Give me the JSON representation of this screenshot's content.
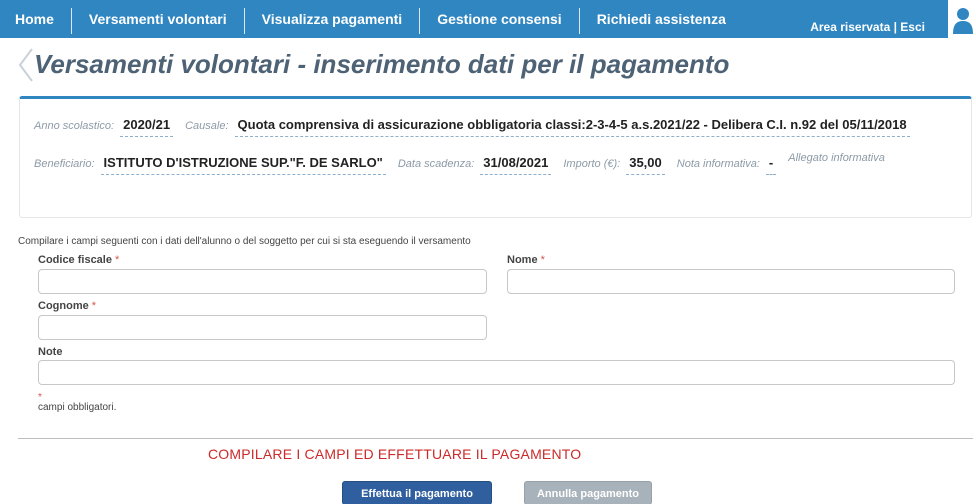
{
  "nav": {
    "items": [
      {
        "label": "Home"
      },
      {
        "label": "Versamenti volontari"
      },
      {
        "label": "Visualizza pagamenti"
      },
      {
        "label": "Gestione consensi"
      },
      {
        "label": "Richiedi assistenza"
      }
    ],
    "area_link": "Area riservata | Esci",
    "user_icon": "user-silhouette-icon",
    "bar_color": "#2f86c0"
  },
  "page": {
    "title": "Versamenti volontari - inserimento dati per il pagamento"
  },
  "info": {
    "anno_label": "Anno scolastico:",
    "anno_value": "2020/21",
    "causale_label": "Causale:",
    "causale_value": "Quota comprensiva di assicurazione obbligatoria classi:2-3-4-5 a.s.2021/22 - Delibera C.I. n.92 del 05/11/2018",
    "beneficiario_label": "Beneficiario:",
    "beneficiario_value": "ISTITUTO D'ISTRUZIONE SUP.\"F. DE SARLO\"",
    "scadenza_label": "Data scadenza:",
    "scadenza_value": "31/08/2021",
    "importo_label": "Importo (€):",
    "importo_value": "35,00",
    "nota_label": "Nota informativa:",
    "nota_value": "-",
    "allegato_label": "Allegato informativa"
  },
  "form": {
    "intro": "Compilare i campi seguenti con i dati dell'alunno o del soggetto per cui si sta eseguendo il versamento",
    "codice_fiscale_label": "Codice fiscale",
    "nome_label": "Nome",
    "cognome_label": "Cognome",
    "note_label": "Note",
    "required_marker": "*",
    "codice_fiscale_value": "",
    "nome_value": "",
    "cognome_value": "",
    "note_value": "",
    "required_note": "campi obbligatori."
  },
  "warning": "COMPILARE I CAMPI ED EFFETTUARE IL PAGAMENTO",
  "buttons": {
    "pay": "Effettua il pagamento",
    "cancel": "Annulla pagamento"
  }
}
